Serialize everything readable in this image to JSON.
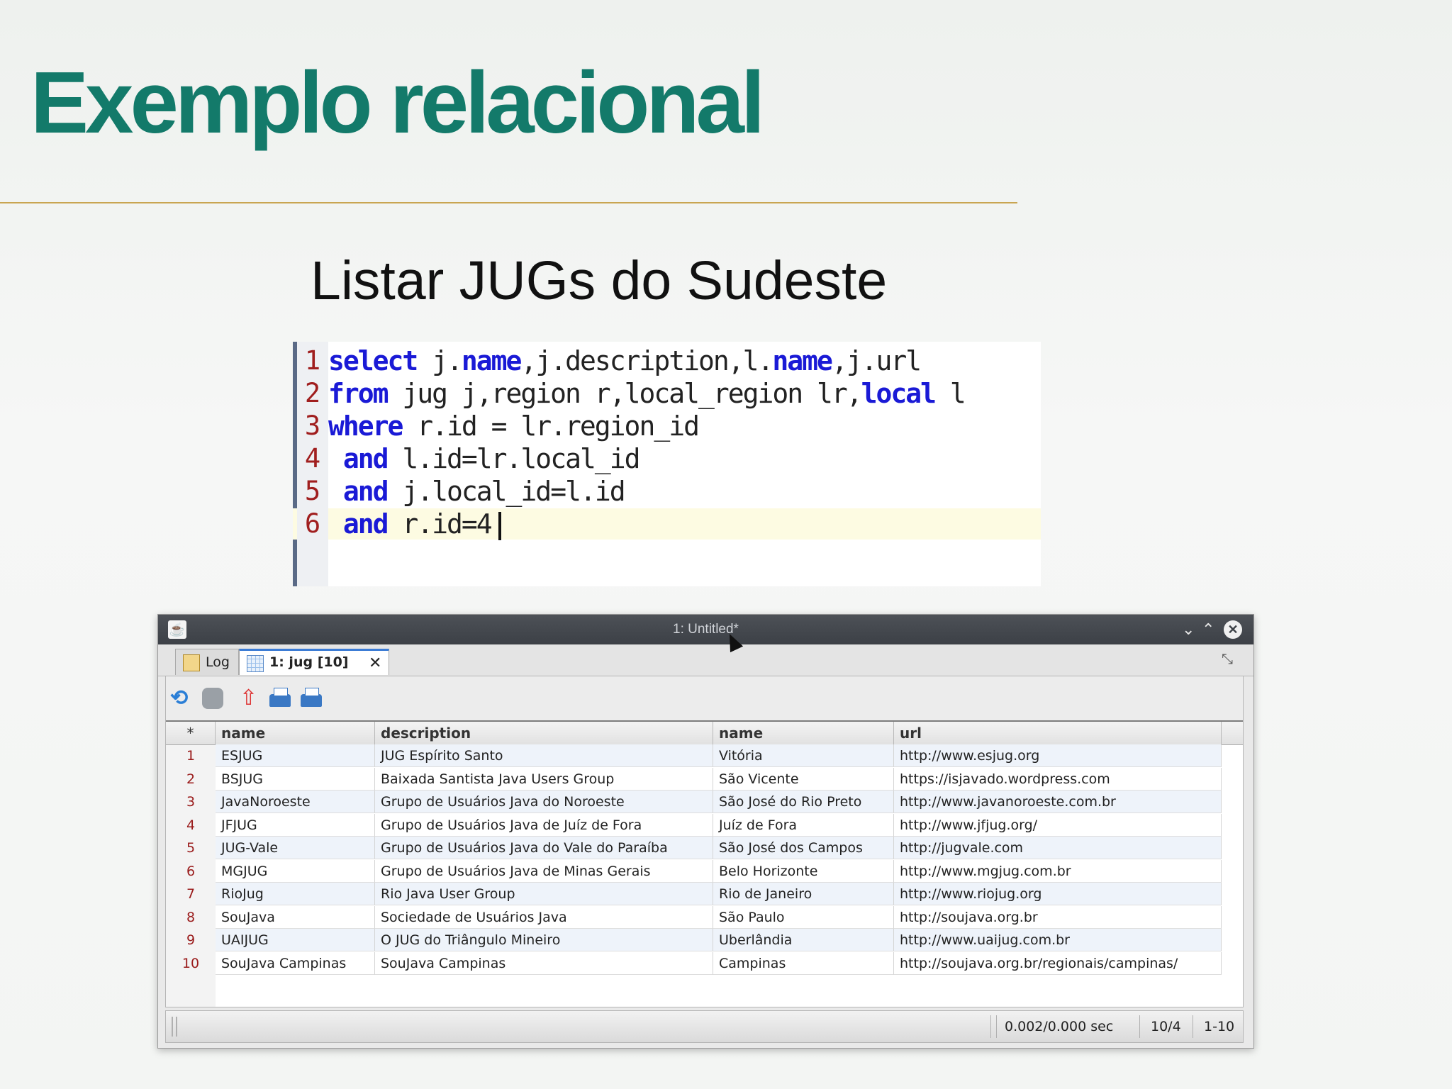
{
  "slide": {
    "title": "Exemplo relacional",
    "subtitle": "Listar JUGs do Sudeste"
  },
  "sql": {
    "lines": [
      {
        "num": "1",
        "parts": [
          [
            "kw",
            "select"
          ],
          [
            "t",
            " j."
          ],
          [
            "kw",
            "name"
          ],
          [
            "t",
            ",j.description,l."
          ],
          [
            "kw",
            "name"
          ],
          [
            "t",
            ",j.url"
          ]
        ]
      },
      {
        "num": "2",
        "parts": [
          [
            "kw",
            "from"
          ],
          [
            "t",
            " jug j,region r,local_region lr,"
          ],
          [
            "kw",
            "local"
          ],
          [
            "t",
            " l"
          ]
        ]
      },
      {
        "num": "3",
        "parts": [
          [
            "kw",
            "where"
          ],
          [
            "t",
            " r.id = lr.region_id"
          ]
        ]
      },
      {
        "num": "4",
        "parts": [
          [
            "t",
            " "
          ],
          [
            "kw",
            "and"
          ],
          [
            "t",
            " l.id=lr.local_id"
          ]
        ]
      },
      {
        "num": "5",
        "parts": [
          [
            "t",
            " "
          ],
          [
            "kw",
            "and"
          ],
          [
            "t",
            " j.local_id=l.id"
          ]
        ]
      },
      {
        "num": "6",
        "parts": [
          [
            "t",
            " "
          ],
          [
            "kw",
            "and"
          ],
          [
            "t",
            " r.id=4"
          ]
        ]
      }
    ]
  },
  "window": {
    "title": "1: Untitled*",
    "close_glyph": "✕",
    "minimize_glyph": "⌄",
    "maximize_glyph": "⌃"
  },
  "tabs": {
    "log_label": "Log",
    "result_label": "1: jug [10]",
    "close_glyph": "✕"
  },
  "table": {
    "corner": "*",
    "headers": [
      "name",
      "description",
      "name",
      "url"
    ],
    "rows": [
      [
        "1",
        "ESJUG",
        "JUG Espírito Santo",
        "Vitória",
        "http://www.esjug.org"
      ],
      [
        "2",
        "BSJUG",
        "Baixada Santista Java Users Group",
        "São Vicente",
        "https://isjavado.wordpress.com"
      ],
      [
        "3",
        "JavaNoroeste",
        "Grupo de Usuários Java do Noroeste",
        "São José do Rio Preto",
        "http://www.javanoroeste.com.br"
      ],
      [
        "4",
        "JFJUG",
        "Grupo de Usuários Java de Juíz de Fora",
        "Juíz de Fora",
        "http://www.jfjug.org/"
      ],
      [
        "5",
        "JUG-Vale",
        "Grupo de Usuários Java do Vale do Paraíba",
        "São José dos Campos",
        "http://jugvale.com"
      ],
      [
        "6",
        "MGJUG",
        "Grupo de Usuários Java de Minas Gerais",
        "Belo Horizonte",
        "http://www.mgjug.com.br"
      ],
      [
        "7",
        "RioJug",
        "Rio Java User Group",
        "Rio de Janeiro",
        "http://www.riojug.org"
      ],
      [
        "8",
        "SouJava",
        "Sociedade de Usuários Java",
        "São Paulo",
        "http://soujava.org.br"
      ],
      [
        "9",
        "UAIJUG",
        "O JUG do Triângulo Mineiro",
        "Uberlândia",
        "http://www.uaijug.com.br"
      ],
      [
        "10",
        "SouJava Campinas",
        "SouJava Campinas",
        "Campinas",
        "http://soujava.org.br/regionais/campinas/"
      ]
    ]
  },
  "status": {
    "time": "0.002/0.000 sec",
    "rows": "10/4",
    "range": "1-10"
  },
  "icons": {
    "app": "java-app-icon",
    "refresh": "refresh-icon",
    "stop": "stop-icon",
    "export": "export-icon",
    "print": "print-icon",
    "print_preview": "print-preview-icon",
    "restore": "restore-icon"
  },
  "colors": {
    "title": "#137a6a",
    "keyword": "#1a1ad6",
    "line_number": "#a01e1e"
  }
}
